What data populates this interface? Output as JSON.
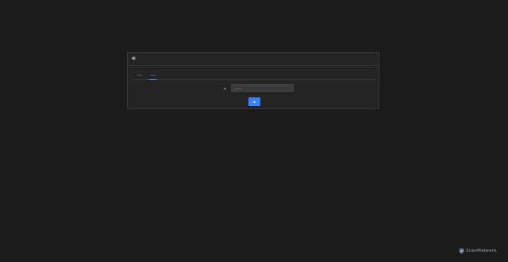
{
  "dialog": {
    "title": "■"
  },
  "tabs": [
    {
      "label": "▭▭"
    },
    {
      "label": "▭▭",
      "active": true
    }
  ],
  "form": {
    "field_label": "▪",
    "input_placeholder": "▭▭",
    "submit_label": "▪"
  },
  "watermark": {
    "text": "ScanMalware",
    "logo_icon": "scanmalware-logo-icon"
  },
  "colors": {
    "accent": "#3b82f6",
    "background": "#1b1b1b",
    "panel": "#242424"
  }
}
